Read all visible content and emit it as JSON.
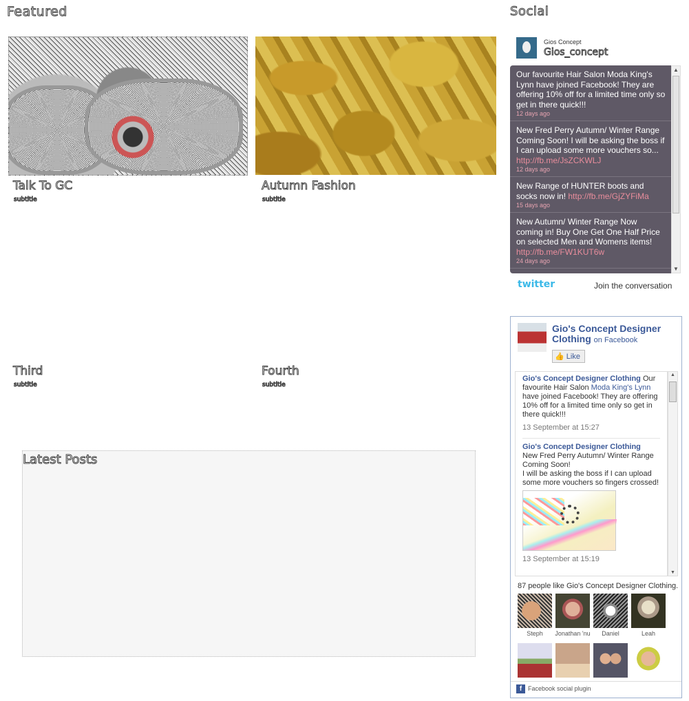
{
  "featured": {
    "title": "Featured",
    "posts": [
      {
        "title": "Talk To GC",
        "subtitle": "subtitle"
      },
      {
        "title": "Autumn Fashion",
        "subtitle": "subtitle"
      },
      {
        "title": "Third",
        "subtitle": "subtitle"
      },
      {
        "title": "Fourth",
        "subtitle": "subtitle"
      }
    ]
  },
  "latest": {
    "title": "Latest Posts"
  },
  "social": {
    "title": "Social"
  },
  "twitter": {
    "account_name": "Gios Concept",
    "handle": "Gios_concept",
    "logo": "twitter",
    "join": "Join the conversation",
    "tweets": [
      {
        "text": "Our favourite Hair Salon Moda King's Lynn have joined Facebook! They are offering 10% off for a limited time only so get in there quick!!!",
        "link": "",
        "time": "12 days ago"
      },
      {
        "text": "New Fred Perry Autumn/ Winter Range Coming Soon! I will be asking the boss if I can upload some more vouchers so... ",
        "link": "http://fb.me/JsZCKWLJ",
        "time": "12 days ago"
      },
      {
        "text": "New Range of HUNTER boots and socks now in! ",
        "link": "http://fb.me/GjZYFiMa",
        "time": "15 days ago"
      },
      {
        "text": "New Autumn/ Winter Range Now coming in! Buy One Get One Half Price on selected Men and Womens items! ",
        "link": "http://fb.me/FW1KUT6w",
        "time": "24 days ago"
      }
    ]
  },
  "facebook": {
    "page_name": "Gio's Concept Designer Clothing",
    "on_facebook": "on Facebook",
    "like": "Like",
    "posts": [
      {
        "author": "Gio's Concept Designer Clothing",
        "pre": " Our favourite Hair Salon ",
        "link": "Moda King's Lynn",
        "post": " have joined Facebook! They are offering 10% off for a limited time only so get in there quick!!!",
        "date": "13 September at 15:27"
      },
      {
        "author": "Gio's Concept Designer Clothing",
        "line1": "New Fred Perry Autumn/ Winter Range Coming Soon!",
        "line2": "I will be asking the boss if I can upload some more vouchers so fingers crossed!",
        "date": "13 September at 15:19"
      }
    ],
    "likes_count": "87 people like Gio's Concept Designer Clothing.",
    "faces": [
      "Steph",
      "Jonathan 'nu",
      "Daniel",
      "Leah",
      "",
      "",
      "",
      ""
    ],
    "plugin": "Facebook social plugin"
  }
}
